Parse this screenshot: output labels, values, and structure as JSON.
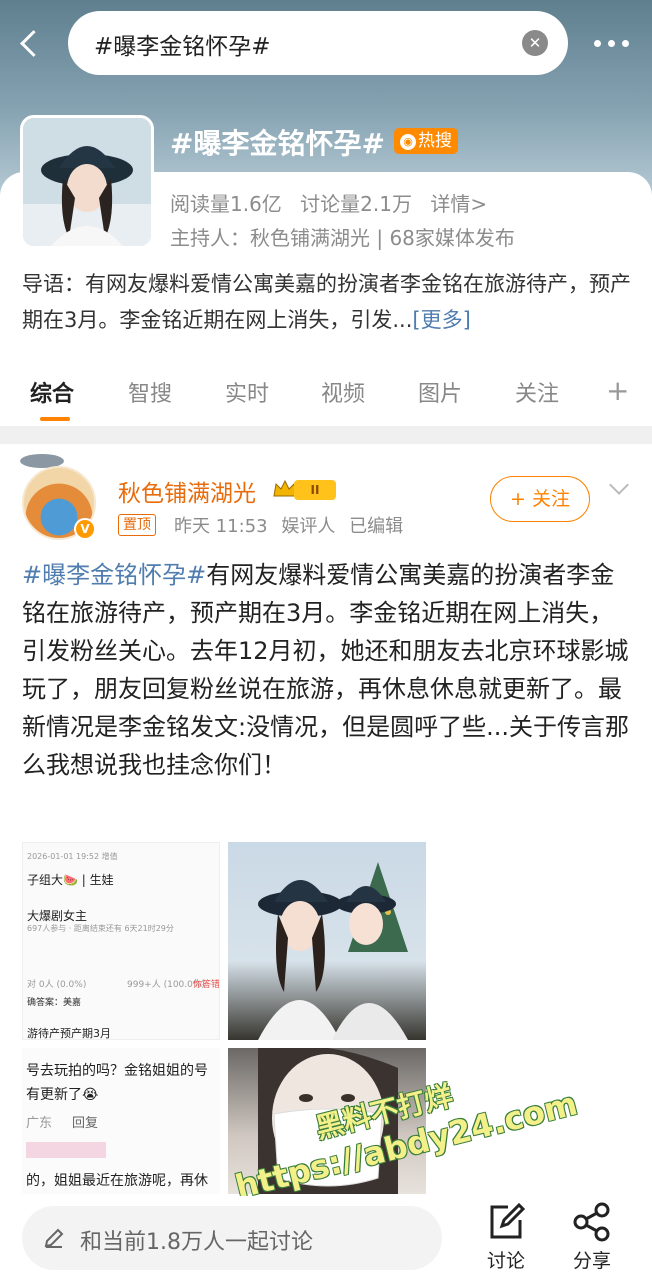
{
  "search": {
    "query": "#曝李金铭怀孕#"
  },
  "topic": {
    "title": "#曝李金铭怀孕#",
    "hot_badge": "热搜",
    "reads": "阅读量1.6亿",
    "discussions": "讨论量2.1万",
    "details": "详情>",
    "host": "主持人：秋色铺满湖光 | 68家媒体发布",
    "intro": "导语：有网友爆料爱情公寓美嘉的扮演者李金铭在旅游待产，预产期在3月。李金铭近期在网上消失，引发...",
    "intro_more": "[更多]"
  },
  "tabs": [
    "综合",
    "智搜",
    "实时",
    "视频",
    "图片",
    "关注"
  ],
  "post": {
    "username": "秋色铺满湖光",
    "level": "II",
    "pinned": "置顶",
    "time": "昨天 11:53",
    "role": "娱评人",
    "edited": "已编辑",
    "follow": "+ 关注",
    "hashtag": "#曝李金铭怀孕#",
    "body": "有网友爆料爱情公寓美嘉的扮演者李金铭在旅游待产，预产期在3月。李金铭近期在网上消失，引发粉丝关心。去年12月初，她还和朋友去北京环球影城玩了，朋友回复粉丝说在旅游，再休息休息就更新了。最新情况是李金铭发文:没情况，但是圆呼了些...关于传言那么我想说我也挂念你们！",
    "image1": {
      "line1": "2026-01-01 19:52 增值",
      "line2": "子组大🍉 | 生娃",
      "line3": "大爆剧女主",
      "line4": "697人参与 · 距离结束还有 6天21时29分",
      "line5": "对 0人 (0.0%)",
      "line6": "999+人 (100.0%)",
      "line7": "你答错了",
      "line8": "确答案：美嘉",
      "line9": "游待产预产期3月"
    },
    "image3": {
      "line1": "号去玩拍的吗？金铭姐姐的号",
      "line2": "有更新了😭",
      "line3": "广东",
      "line4": "回复",
      "line5": "的，姐姐最近在旅游呢，再休"
    },
    "watermark_line1": "黑料不打烊",
    "watermark_line2": "https://abdy24.com"
  },
  "bottom": {
    "comment_placeholder": "和当前1.8万人一起讨论",
    "discuss": "讨论",
    "share": "分享"
  }
}
